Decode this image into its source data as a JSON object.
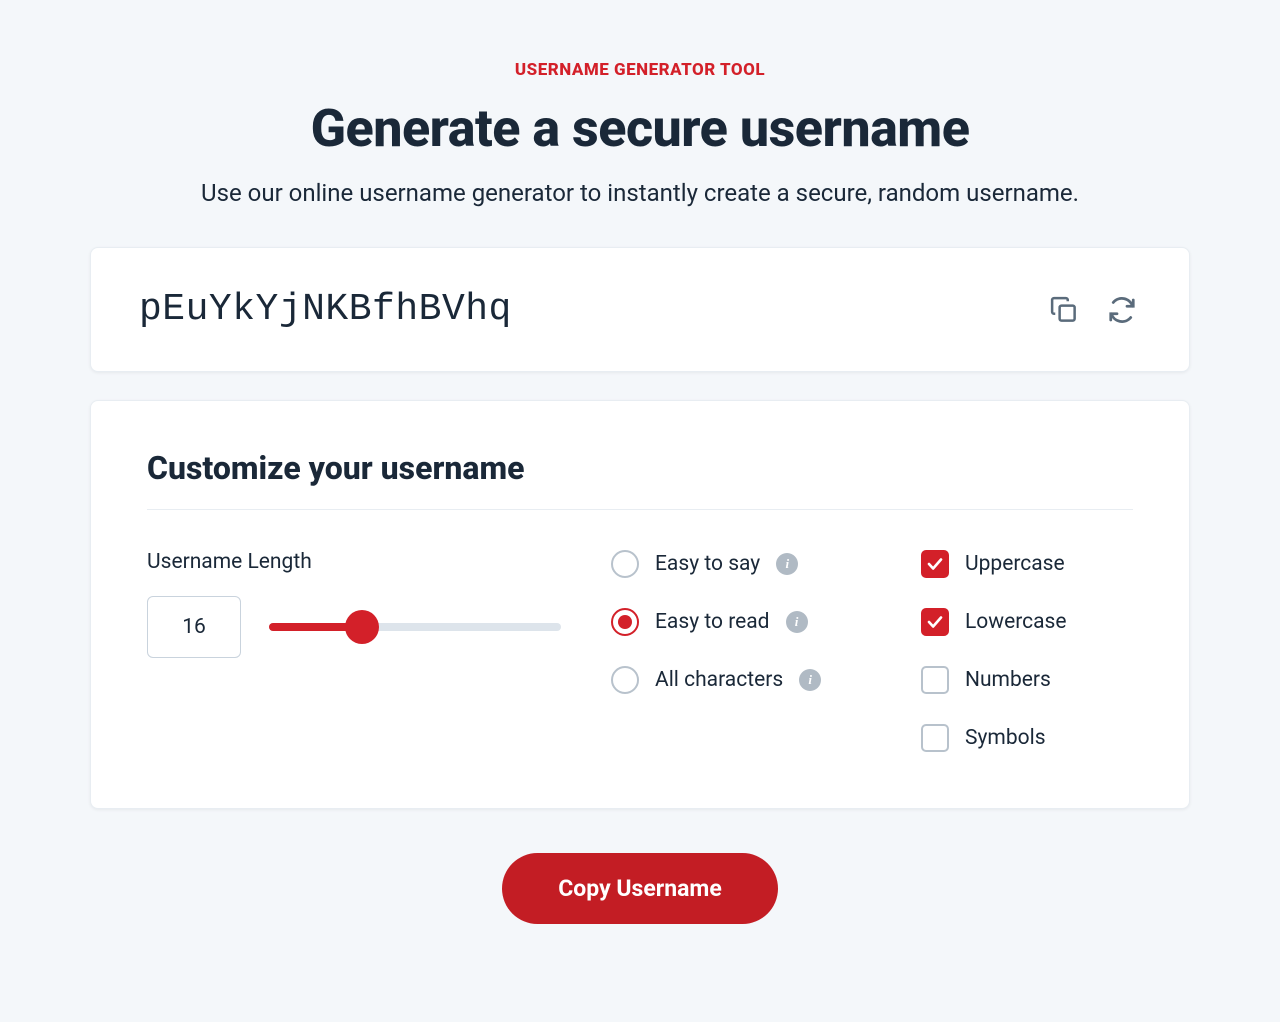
{
  "header": {
    "eyebrow": "USERNAME GENERATOR TOOL",
    "title": "Generate a secure username",
    "subtitle": "Use our online username generator to instantly create a secure, random username."
  },
  "output": {
    "value": "pEuYkYjNKBfhBVhq"
  },
  "customize": {
    "title": "Customize your username",
    "length_label": "Username Length",
    "length_value": "16",
    "radios": [
      {
        "label": "Easy to say",
        "checked": false
      },
      {
        "label": "Easy to read",
        "checked": true
      },
      {
        "label": "All characters",
        "checked": false
      }
    ],
    "checks": [
      {
        "label": "Uppercase",
        "checked": true
      },
      {
        "label": "Lowercase",
        "checked": true
      },
      {
        "label": "Numbers",
        "checked": false
      },
      {
        "label": "Symbols",
        "checked": false
      }
    ]
  },
  "cta": {
    "label": "Copy Username"
  }
}
